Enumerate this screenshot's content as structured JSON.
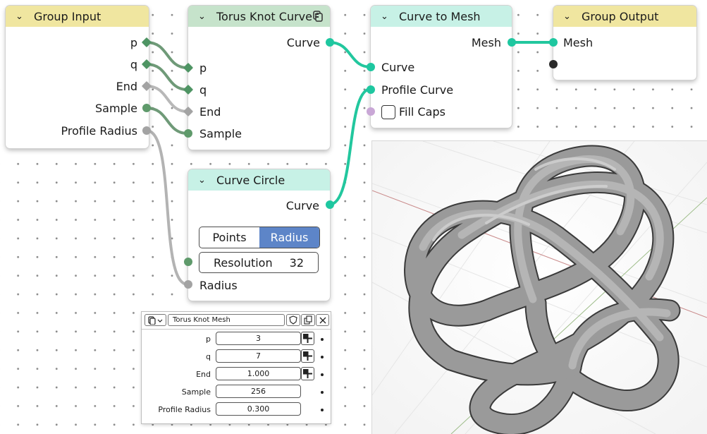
{
  "nodes": {
    "group_input": {
      "title": "Group Input",
      "outputs": [
        "p",
        "q",
        "End",
        "Sample",
        "Profile Radius"
      ]
    },
    "torus_knot": {
      "title": "Torus Knot Curve",
      "output": "Curve",
      "inputs": [
        "p",
        "q",
        "End",
        "Sample"
      ]
    },
    "curve_to_mesh": {
      "title": "Curve to Mesh",
      "output": "Mesh",
      "inputs": [
        "Curve",
        "Profile Curve"
      ],
      "fill_caps_label": "Fill Caps"
    },
    "group_output": {
      "title": "Group Output",
      "input": "Mesh"
    },
    "curve_circle": {
      "title": "Curve Circle",
      "output": "Curve",
      "modes": [
        "Points",
        "Radius"
      ],
      "active_mode": "Radius",
      "resolution_label": "Resolution",
      "resolution_value": "32",
      "radius_label": "Radius"
    }
  },
  "modifier_panel": {
    "name": "Torus Knot Mesh",
    "fields": [
      {
        "label": "p",
        "value": "3"
      },
      {
        "label": "q",
        "value": "7"
      },
      {
        "label": "End",
        "value": "1.000"
      },
      {
        "label": "Sample",
        "value": "256"
      },
      {
        "label": "Profile Radius",
        "value": "0.300"
      }
    ]
  },
  "colors": {
    "geometry_socket": "#1ec7a0",
    "integer_socket": "#4e9463",
    "float_socket": "#a3a3a3",
    "boolean_socket": "#c9a7d6",
    "active_toggle": "#5d85c8"
  }
}
